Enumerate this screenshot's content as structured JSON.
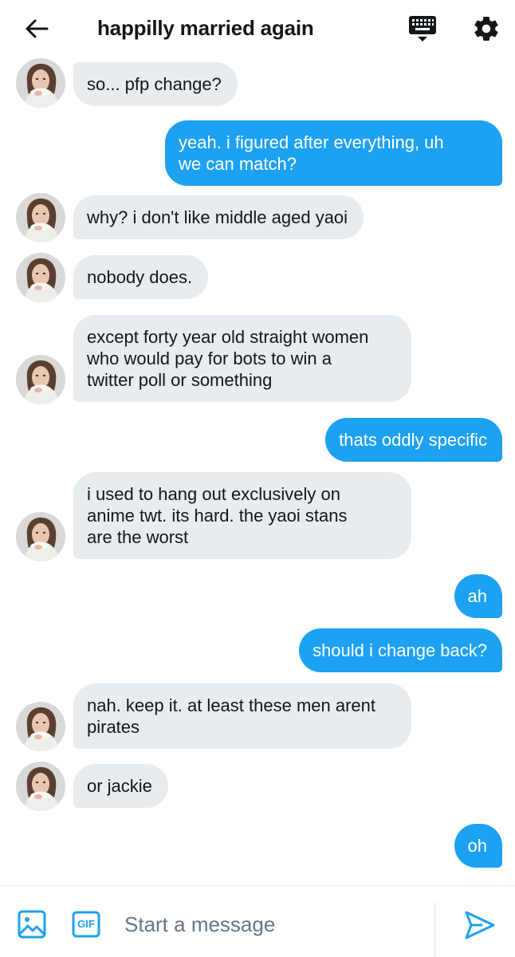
{
  "header": {
    "title": "happilly married again",
    "icons": {
      "back": "arrow-left-icon",
      "keyboard": "keyboard-icon",
      "settings": "gear-icon"
    }
  },
  "colors": {
    "accent": "#1da1f2",
    "incoming_bubble": "#e6ecf0",
    "text": "#14171a",
    "muted": "#657786"
  },
  "messages": [
    {
      "from": "them",
      "text": "so... pfp change?"
    },
    {
      "from": "me",
      "text": "yeah. i figured after everything, uh\nwe can match?"
    },
    {
      "from": "them",
      "text": "why? i don't like middle aged yaoi"
    },
    {
      "from": "them",
      "text": "nobody does."
    },
    {
      "from": "them",
      "text": "except forty year old straight women\nwho would pay for bots to win a\ntwitter poll or something"
    },
    {
      "from": "me",
      "text": "thats oddly specific"
    },
    {
      "from": "them",
      "text": "i used to hang out exclusively on\nanime twt. its hard. the yaoi stans\nare the worst"
    },
    {
      "from": "me",
      "text": "ah"
    },
    {
      "from": "me",
      "text": "should i change back?"
    },
    {
      "from": "them",
      "text": "nah. keep it. at least these men arent\npirates"
    },
    {
      "from": "them",
      "text": "or jackie"
    },
    {
      "from": "me",
      "text": "oh"
    }
  ],
  "composer": {
    "placeholder": "Start a message",
    "gif_label": "GIF",
    "icons": {
      "image": "image-icon",
      "gif": "gif-icon",
      "send": "send-icon"
    }
  }
}
